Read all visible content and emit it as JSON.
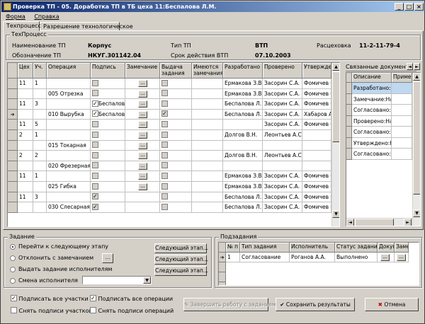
{
  "window": {
    "title": "Проверка ТП - 05. Доработка  ТП в ТБ цеха 11:Беспалова Л.М.",
    "btn_min": "_",
    "btn_max": "□",
    "btn_close": "×"
  },
  "menu": [
    "Форма",
    "Справка"
  ],
  "tabs": [
    "Техпроцесс",
    "Разрешение технологическое"
  ],
  "techprocess": {
    "group_label": "ТехПроцесс",
    "name_label": "Наименование ТП",
    "name_value": "Корпус",
    "type_label": "Тип ТП",
    "type_value": "ВТП",
    "route_label": "Расцеховка",
    "route_value": "11-2-11-79-4",
    "designation_label": "Обозначение ТП",
    "designation_value": "НКУГ.301142.04",
    "validity_label": "Срок действия ВТП",
    "validity_value": "07.10.2003"
  },
  "ops_grid": {
    "headers": [
      "Цех",
      "Уч.",
      "Операция",
      "Подпись",
      "Замечание",
      "Выдача задания",
      "Имеются замечания",
      "Разработано",
      "Проверено",
      "Утвержде"
    ],
    "rows": [
      {
        "shop": "11",
        "area": "1",
        "op": "",
        "sign": "",
        "sign_chk": "dis",
        "ell": true,
        "issue_chk": "dis",
        "dev": "Ермакова З.В.",
        "chk": "Засорин С.А.",
        "appr": "Фомичев С"
      },
      {
        "shop": "",
        "area": "",
        "op": "005 Отрезка",
        "sign": "",
        "sign_chk": "dis",
        "ell": true,
        "issue_chk": "dis",
        "dev": "Ермакова З.В.",
        "chk": "Засорин С.А.",
        "appr": "Фомичев С"
      },
      {
        "shop": "11",
        "area": "3",
        "op": "",
        "sign": "Беспалова",
        "sign_chk": "on",
        "ell": true,
        "issue_chk": "dis",
        "dev": "Беспалова Л.М.",
        "chk": "Засорин С.А.",
        "appr": "Фомичев С"
      },
      {
        "shop": "",
        "area": "",
        "op": "010 Вырубка",
        "sign": "Беспалова",
        "sign_chk": "on",
        "ell": true,
        "issue_chk": "dison",
        "dev": "Беспалова Л.М.",
        "chk": "Засорин С.А.",
        "appr": "Хабаров А"
      },
      {
        "shop": "11",
        "area": "5",
        "op": "",
        "sign": "",
        "sign_chk": "dis",
        "ell": true,
        "issue_chk": "dis",
        "dev": "",
        "chk": "Засорин С.А.",
        "appr": "Фомичев С"
      },
      {
        "shop": "2",
        "area": "1",
        "op": "",
        "sign": "",
        "sign_chk": "dis",
        "ell": true,
        "issue_chk": "dis",
        "dev": "Долгов В.Н.",
        "chk": "Леонтьев А.С.",
        "appr": ""
      },
      {
        "shop": "",
        "area": "",
        "op": "015 Токарная",
        "sign": "",
        "sign_chk": "dis",
        "ell": true,
        "issue_chk": "dis",
        "dev": "",
        "chk": "",
        "appr": ""
      },
      {
        "shop": "2",
        "area": "2",
        "op": "",
        "sign": "",
        "sign_chk": "dis",
        "ell": true,
        "issue_chk": "dis",
        "dev": "Долгов В.Н.",
        "chk": "Леонтьев А.С.",
        "appr": ""
      },
      {
        "shop": "",
        "area": "",
        "op": "020 Фрезерная",
        "sign": "",
        "sign_chk": "dis",
        "ell": true,
        "issue_chk": "dis",
        "dev": "",
        "chk": "",
        "appr": ""
      },
      {
        "shop": "11",
        "area": "1",
        "op": "",
        "sign": "",
        "sign_chk": "dis",
        "ell": true,
        "issue_chk": "dis",
        "dev": "Ермакова З.В.",
        "chk": "Засорин С.А.",
        "appr": "Фомичев С"
      },
      {
        "shop": "",
        "area": "",
        "op": "025 Гибка",
        "sign": "",
        "sign_chk": "dis",
        "ell": true,
        "issue_chk": "dis",
        "dev": "Ермакова З.В.",
        "chk": "Засорин С.А.",
        "appr": "Фомичев С"
      },
      {
        "shop": "11",
        "area": "3",
        "op": "",
        "sign": "",
        "sign_chk": "dison",
        "ell": false,
        "issue_chk": "dis",
        "dev": "Беспалова Л.М.",
        "chk": "Засорин С.А.",
        "appr": "Фомичев С"
      },
      {
        "shop": "",
        "area": "",
        "op": "030 Слесарная",
        "sign": "",
        "sign_chk": "dison",
        "ell": false,
        "issue_chk": "dis",
        "dev": "Беспалова Л.М.",
        "chk": "Засорин С.А.",
        "appr": "Фомичев С"
      }
    ]
  },
  "docs_panel": {
    "title": "Связанные документы",
    "headers": [
      "Описание",
      "Приме"
    ],
    "items": [
      "Разработано:Стар",
      "Замечание:Начал",
      "Согласовано:Начал",
      "Проверено:Начал",
      "Согласовано:Техн",
      "Утверждено:Начал",
      "Согласовано:Инж"
    ]
  },
  "task": {
    "group_label": "Задание",
    "options": [
      "Перейти к следующему этапу",
      "Отклонить с замечанием",
      "Выдать задание исполнителям",
      "Смена исполнителя"
    ],
    "next_stage_buttons": [
      "Следующий этап...",
      "Следующий этап...",
      "Следующий этап..."
    ]
  },
  "subtasks": {
    "group_label": "Подзадания",
    "headers": [
      "№ п",
      "Тип задания",
      "Исполнитель",
      "Статус задания",
      "Докум",
      "Заме"
    ],
    "rows": [
      {
        "n": "1",
        "type": "Согласование",
        "executor": "Роганов А.А.",
        "status": "Выполнено"
      }
    ]
  },
  "footer": {
    "sign_all_areas": "Подписать все участки",
    "remove_area_signs": "Снять подписи участков",
    "sign_all_ops": "Подписать все операции",
    "remove_op_signs": "Снять подписи операций",
    "finish": "Завершить работу с заданием",
    "save": "Сохранить результаты",
    "cancel": "Отмена"
  }
}
